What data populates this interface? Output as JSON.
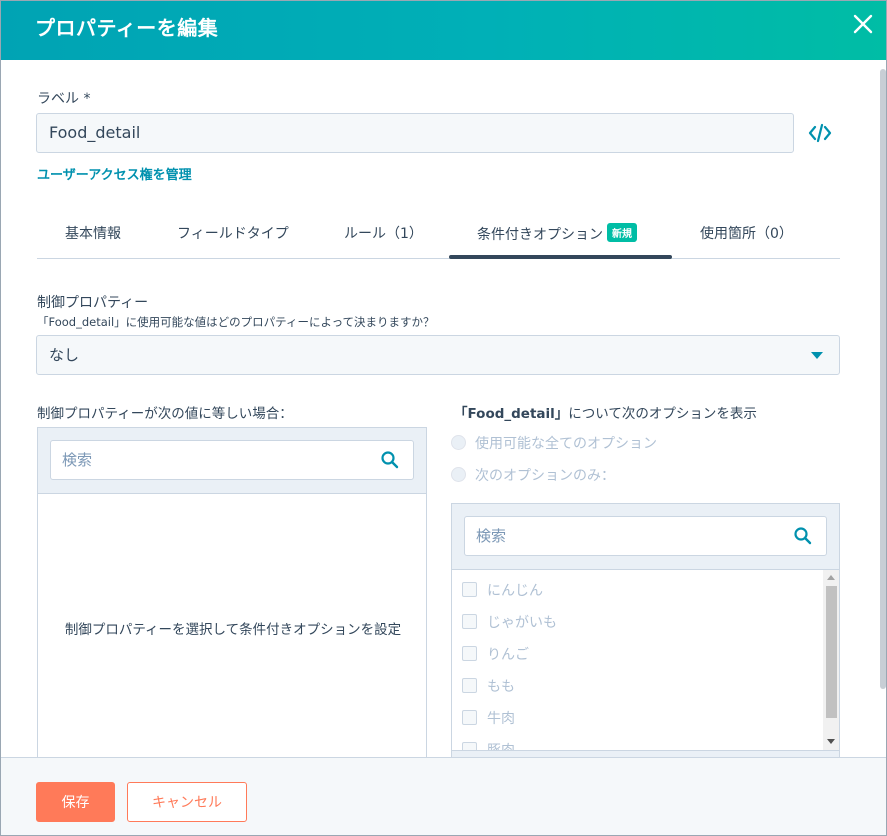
{
  "dialog": {
    "title": "プロパティーを編集",
    "close_icon": "close-icon"
  },
  "label_field": {
    "label": "ラベル *",
    "value": "Food_detail",
    "code_icon": "code-icon"
  },
  "manage_access_link": "ユーザーアクセス権を管理",
  "tabs": [
    {
      "label": "基本情報"
    },
    {
      "label": "フィールドタイプ"
    },
    {
      "label": "ルール（1）"
    },
    {
      "label": "条件付きオプション",
      "badge": "新規",
      "active": true
    },
    {
      "label": "使用箇所（0）"
    }
  ],
  "controlling_property": {
    "title": "制御プロパティー",
    "description": "「Food_detail」に使用可能な値はどのプロパティーによって決まりますか？",
    "selected": "なし"
  },
  "left_panel": {
    "title": "制御プロパティーが次の値に等しい場合：",
    "search_placeholder": "検索",
    "empty_message": "制御プロパティーを選択して条件付きオプションを設定"
  },
  "right_panel": {
    "title_prefix": "「Food_detail」",
    "title_suffix": "について次のオプションを表示",
    "radio_all": "使用可能な全てのオプション",
    "radio_only": "次のオプションのみ：",
    "search_placeholder": "検索",
    "options": [
      "にんじん",
      "じゃがいも",
      "りんご",
      "もも",
      "牛肉",
      "豚肉"
    ]
  },
  "footer": {
    "save_label": "保存",
    "cancel_label": "キャンセル"
  },
  "colors": {
    "header_start": "#00a3b4",
    "header_end": "#00bda5",
    "link": "#0091ae",
    "primary_button": "#ff7a59",
    "text": "#33475b",
    "badge": "#00bda5"
  }
}
